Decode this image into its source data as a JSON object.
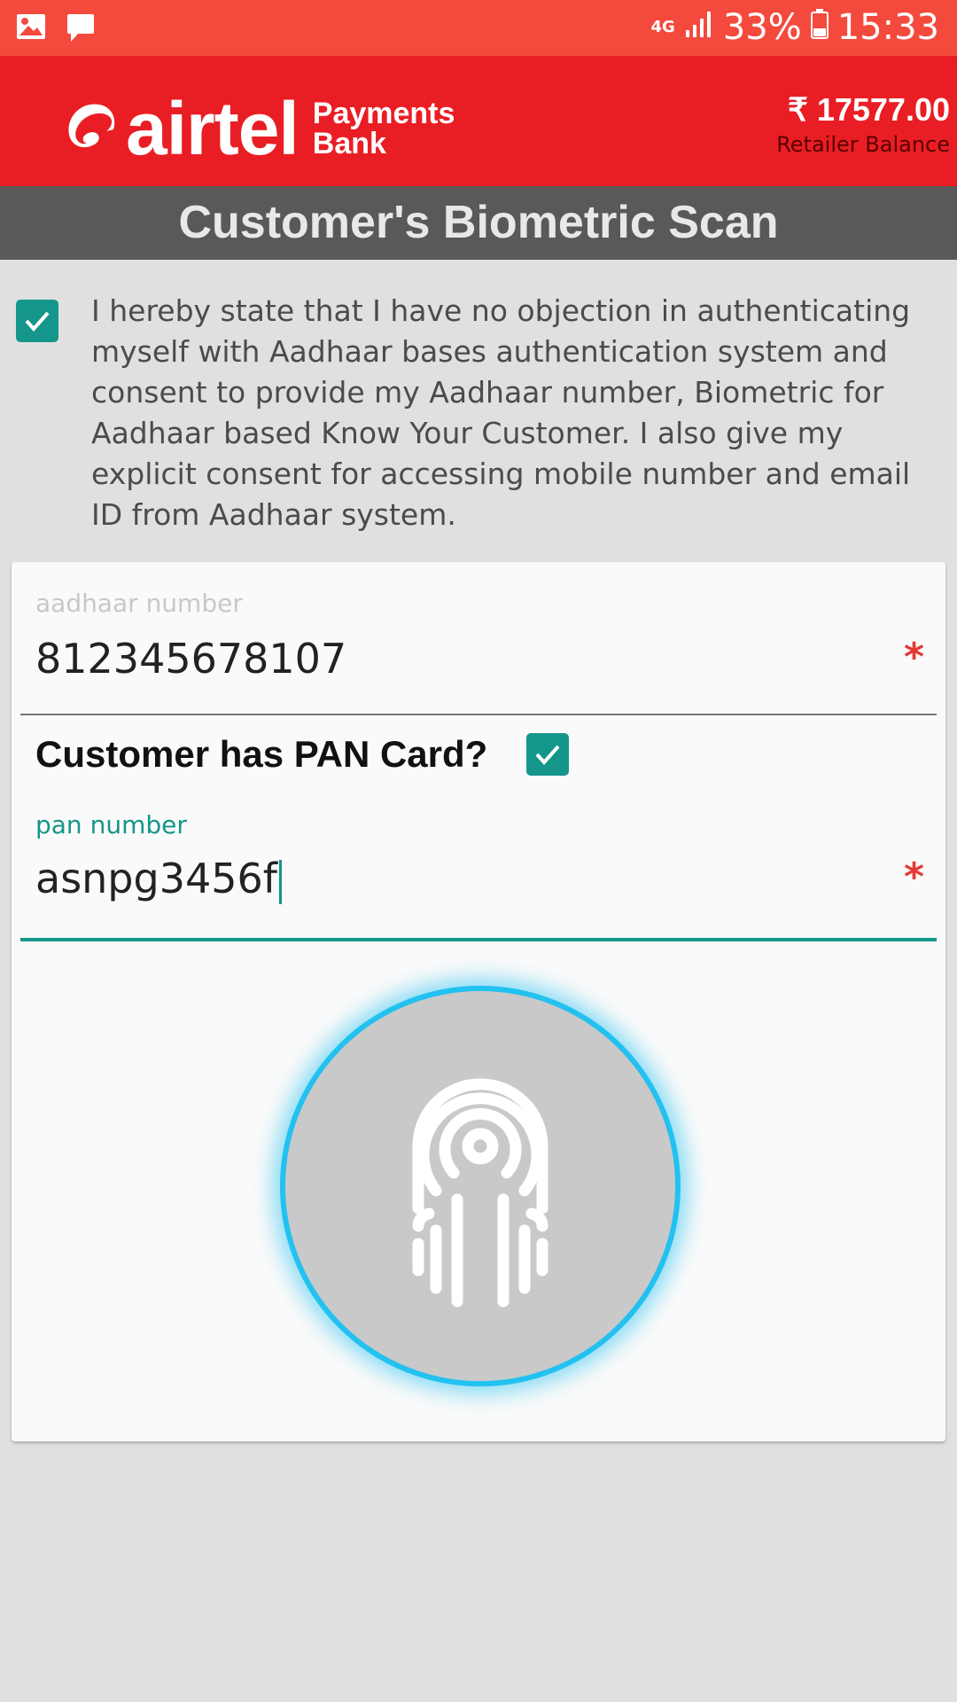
{
  "status_bar": {
    "network_type": "4G",
    "battery": "33%",
    "time": "15:33",
    "left_icons": [
      "gallery-icon",
      "message-icon"
    ],
    "right_icons": [
      "signal-icon",
      "battery-icon"
    ]
  },
  "header": {
    "brand": "airtel",
    "brand_sub_line1": "Payments",
    "brand_sub_line2": "Bank",
    "balance_amount": "₹ 17577.00",
    "balance_label": "Retailer Balance"
  },
  "title": "Customer's Biometric Scan",
  "consent": {
    "checked": true,
    "text": "I hereby state that I have no objection in authenticating myself with Aadhaar bases authentication system and consent to provide my Aadhaar number, Biometric for Aadhaar based Know Your Customer. I also give my explicit consent for accessing mobile number and email ID from Aadhaar system."
  },
  "form": {
    "aadhaar": {
      "label": "aadhaar number",
      "value": "812345678107",
      "required_mark": "*"
    },
    "pan_question": {
      "label": "Customer has PAN Card?",
      "checked": true
    },
    "pan": {
      "label": "pan number",
      "value": "asnpg3456f",
      "required_mark": "*"
    },
    "scan_button": {
      "icon": "fingerprint-icon"
    }
  },
  "colors": {
    "status_bar": "#f44a3d",
    "header": "#e91e24",
    "title_bar": "#595959",
    "accent_teal": "#15968a",
    "scan_glow": "#22c1f0",
    "required": "#e53935"
  }
}
